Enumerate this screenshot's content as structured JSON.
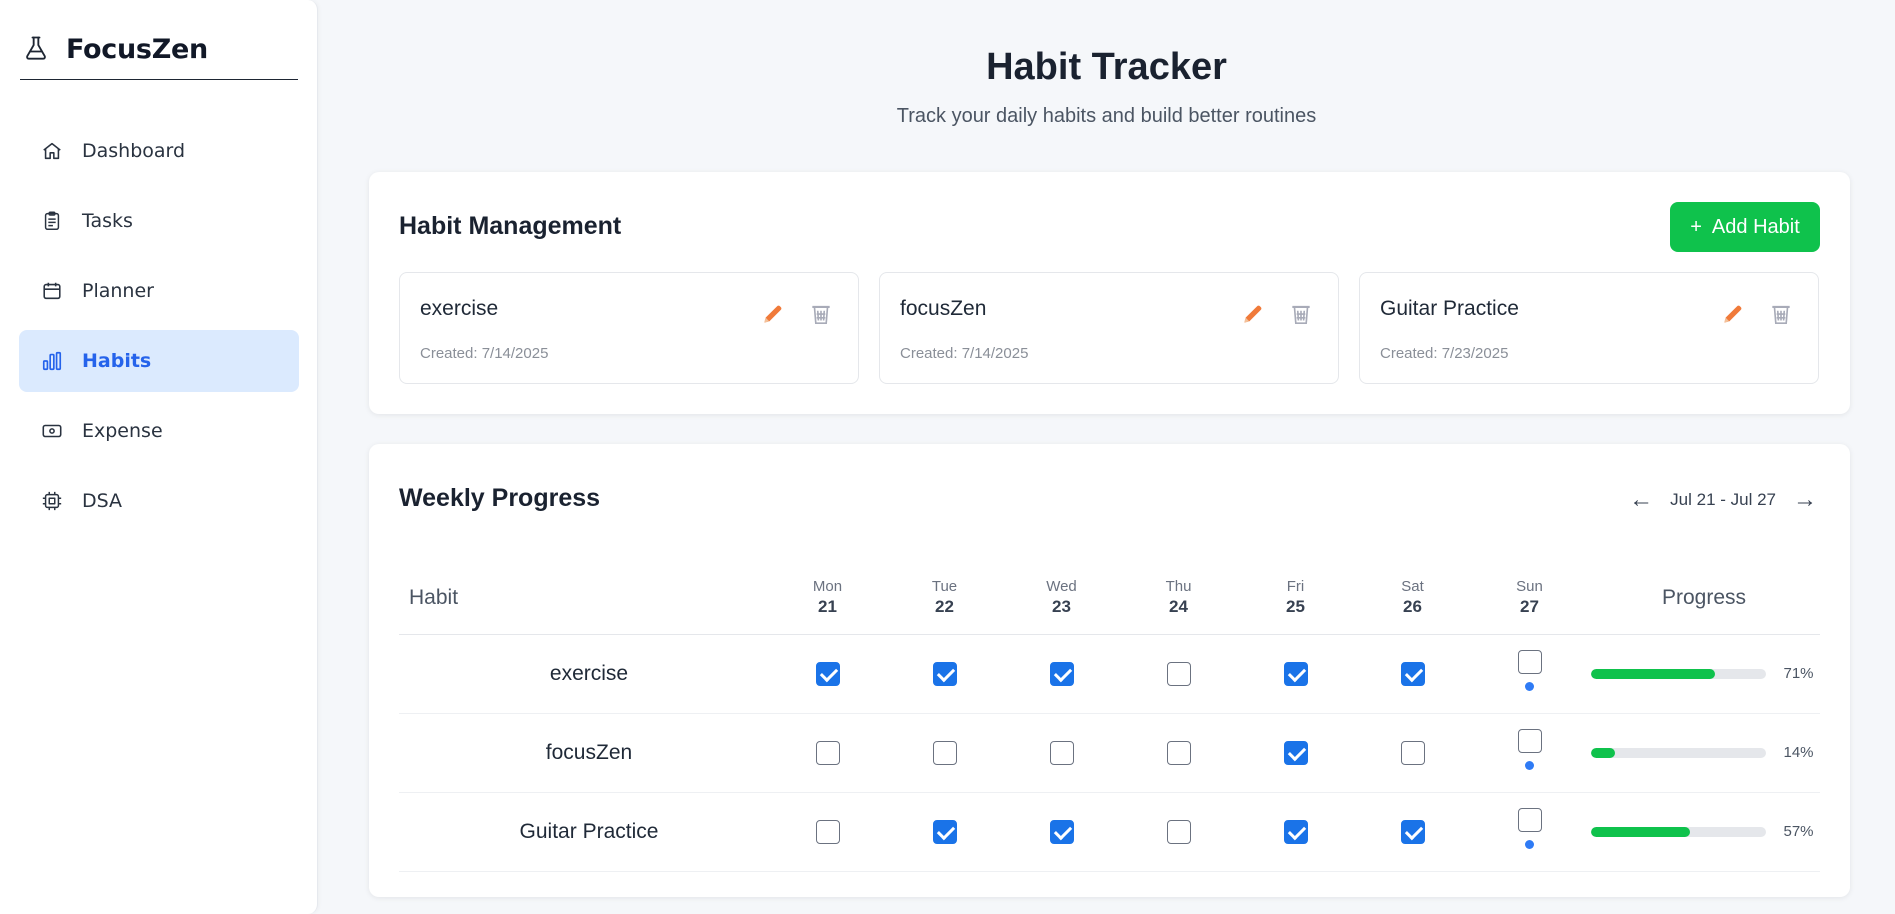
{
  "app": {
    "name": "FocusZen"
  },
  "sidebar": {
    "items": [
      {
        "label": "Dashboard",
        "icon": "home-icon",
        "active": false
      },
      {
        "label": "Tasks",
        "icon": "clipboard-icon",
        "active": false
      },
      {
        "label": "Planner",
        "icon": "calendar-icon",
        "active": false
      },
      {
        "label": "Habits",
        "icon": "bar-chart-icon",
        "active": true
      },
      {
        "label": "Expense",
        "icon": "banknote-icon",
        "active": false
      },
      {
        "label": "DSA",
        "icon": "cpu-icon",
        "active": false
      }
    ]
  },
  "header": {
    "title": "Habit Tracker",
    "subtitle": "Track your daily habits and build better routines"
  },
  "management": {
    "title": "Habit Management",
    "add_label": "Add Habit",
    "add_icon": "+",
    "habits": [
      {
        "name": "exercise",
        "created": "Created: 7/14/2025"
      },
      {
        "name": "focusZen",
        "created": "Created: 7/14/2025"
      },
      {
        "name": "Guitar Practice",
        "created": "Created: 7/23/2025"
      }
    ]
  },
  "weekly": {
    "title": "Weekly Progress",
    "range": "Jul 21 - Jul 27",
    "prev": "←",
    "next": "→",
    "habit_header": "Habit",
    "progress_header": "Progress",
    "days": [
      {
        "name": "Mon",
        "num": "21"
      },
      {
        "name": "Tue",
        "num": "22"
      },
      {
        "name": "Wed",
        "num": "23"
      },
      {
        "name": "Thu",
        "num": "24"
      },
      {
        "name": "Fri",
        "num": "25"
      },
      {
        "name": "Sat",
        "num": "26"
      },
      {
        "name": "Sun",
        "num": "27"
      }
    ],
    "today_index": 6,
    "rows": [
      {
        "habit": "exercise",
        "checks": [
          true,
          true,
          true,
          false,
          true,
          true,
          false
        ],
        "progress": 71,
        "progress_label": "71%"
      },
      {
        "habit": "focusZen",
        "checks": [
          false,
          false,
          false,
          false,
          true,
          false,
          false
        ],
        "progress": 14,
        "progress_label": "14%"
      },
      {
        "habit": "Guitar Practice",
        "checks": [
          false,
          true,
          true,
          false,
          true,
          true,
          false
        ],
        "progress": 57,
        "progress_label": "57%"
      }
    ]
  },
  "colors": {
    "accent": "#2563eb",
    "active_bg": "#dbeafe",
    "add_button": "#0fc24c",
    "progress_fill": "#0fc24c",
    "checkbox_checked": "#1a73e8",
    "edit_icon": "#f07a3a",
    "delete_icon": "#a8abb8",
    "today_dot": "#2f7bf5"
  }
}
